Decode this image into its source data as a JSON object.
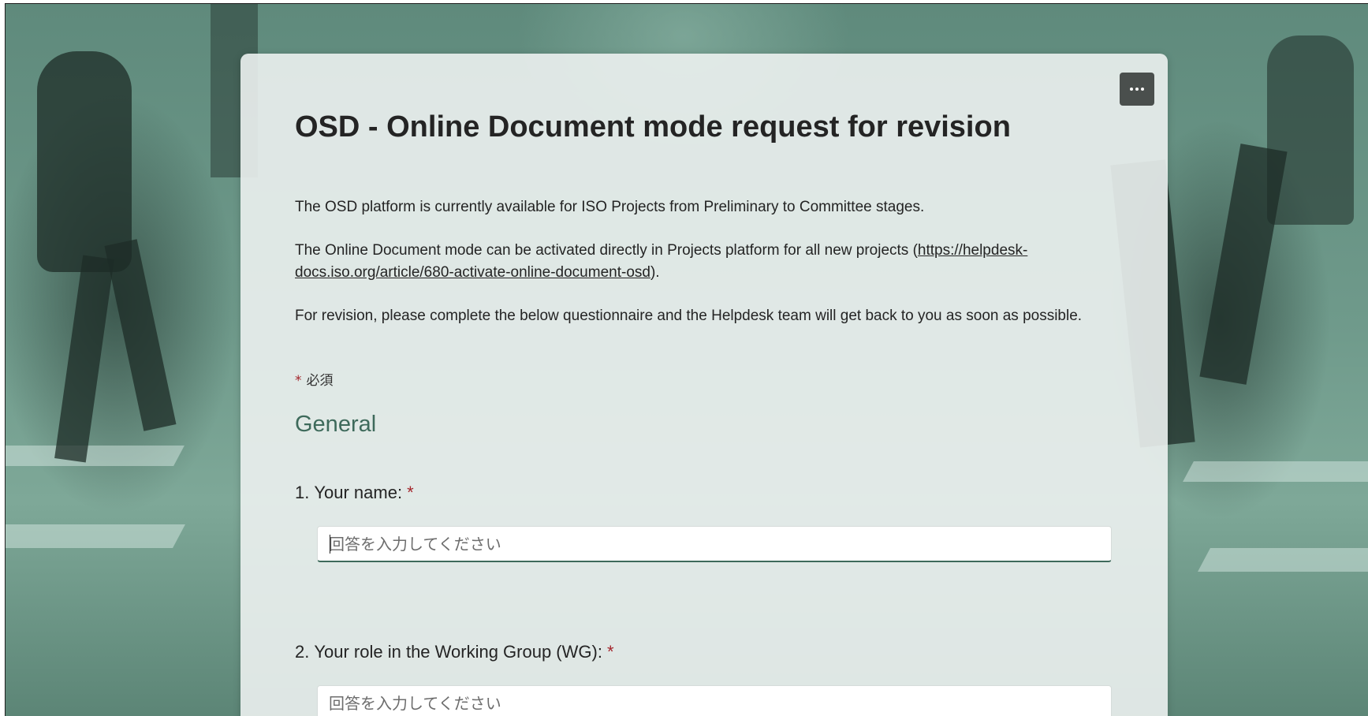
{
  "form": {
    "title": "OSD - Online Document mode request for revision",
    "more_options_label": "...",
    "description": {
      "paragraph1": "The OSD platform is currently available for ISO Projects from Preliminary to Committee stages.",
      "paragraph2_prefix": "The Online Document mode can be activated directly in Projects platform for all new projects (",
      "paragraph2_link": "https://helpdesk-docs.iso.org/article/680-activate-online-document-osd",
      "paragraph2_suffix": ").",
      "paragraph3": "For revision, please complete the below questionnaire and the Helpdesk team will get back to you as soon as possible."
    },
    "required_note": {
      "star": "*",
      "text": "必須"
    },
    "section": {
      "title": "General"
    },
    "questions": [
      {
        "number": "1.",
        "label": "Your name:",
        "required_star": "*",
        "placeholder": "回答を入力してください",
        "value": ""
      },
      {
        "number": "2.",
        "label": "Your role in the Working Group (WG):",
        "required_star": "*",
        "placeholder": "回答を入力してください",
        "value": ""
      }
    ]
  },
  "colors": {
    "accent": "#3e6a5b",
    "required": "#a4262c",
    "text": "#242424"
  }
}
